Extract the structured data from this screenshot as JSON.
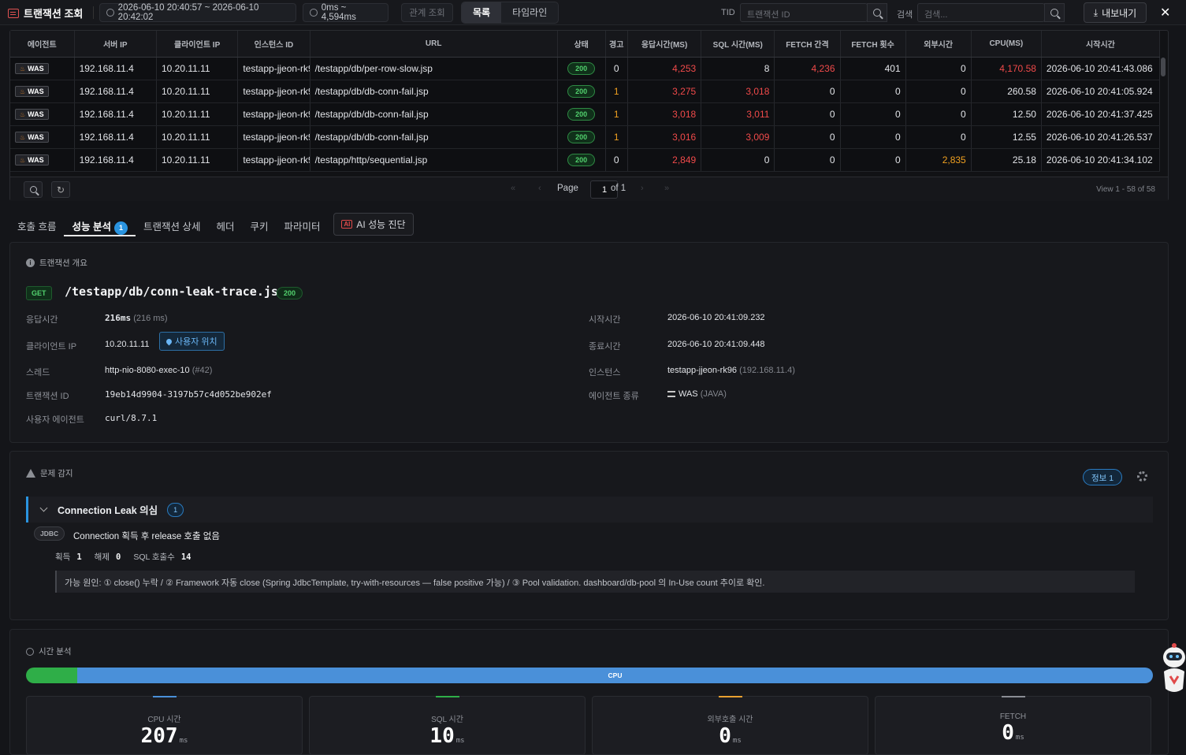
{
  "topbar": {
    "title": "트랜잭션 조회",
    "time_range": "2026-06-10 20:40:57 ~ 2026-06-10 20:42:02",
    "latency_range": "0ms ~ 4,594ms",
    "related_query": "관계 조회",
    "view_list": "목록",
    "view_timeline": "타임라인",
    "tid_label": "TID",
    "tid_placeholder": "트랜잭션 ID",
    "search_label": "검색",
    "search_placeholder": "검색...",
    "export_label": "내보내기"
  },
  "table": {
    "columns": [
      "에이전트",
      "서버 IP",
      "클라이언트 IP",
      "인스턴스 ID",
      "URL",
      "상태",
      "경고",
      "응답시간(MS)",
      "SQL 시간(MS)",
      "FETCH 간격",
      "FETCH 횟수",
      "외부시간",
      "CPU(MS)",
      "시작시간"
    ],
    "rows": [
      {
        "agent": "WAS",
        "server_ip": "192.168.11.4",
        "client_ip": "10.20.11.11",
        "instance": "testapp-jjeon-rk96",
        "url": "/testapp/db/per-row-slow.jsp",
        "status": "200",
        "warn": "0",
        "resp": "4,253",
        "sql": "8",
        "fetch_gap": "4,236",
        "fetch_cnt": "401",
        "ext": "0",
        "cpu": "4,170.58",
        "start": "2026-06-10 20:41:43.086"
      },
      {
        "agent": "WAS",
        "server_ip": "192.168.11.4",
        "client_ip": "10.20.11.11",
        "instance": "testapp-jjeon-rk96",
        "url": "/testapp/db/db-conn-fail.jsp",
        "status": "200",
        "warn": "1",
        "resp": "3,275",
        "sql": "3,018",
        "fetch_gap": "0",
        "fetch_cnt": "0",
        "ext": "0",
        "cpu": "260.58",
        "start": "2026-06-10 20:41:05.924"
      },
      {
        "agent": "WAS",
        "server_ip": "192.168.11.4",
        "client_ip": "10.20.11.11",
        "instance": "testapp-jjeon-rk96",
        "url": "/testapp/db/db-conn-fail.jsp",
        "status": "200",
        "warn": "1",
        "resp": "3,018",
        "sql": "3,011",
        "fetch_gap": "0",
        "fetch_cnt": "0",
        "ext": "0",
        "cpu": "12.50",
        "start": "2026-06-10 20:41:37.425"
      },
      {
        "agent": "WAS",
        "server_ip": "192.168.11.4",
        "client_ip": "10.20.11.11",
        "instance": "testapp-jjeon-rk96",
        "url": "/testapp/db/db-conn-fail.jsp",
        "status": "200",
        "warn": "1",
        "resp": "3,016",
        "sql": "3,009",
        "fetch_gap": "0",
        "fetch_cnt": "0",
        "ext": "0",
        "cpu": "12.55",
        "start": "2026-06-10 20:41:26.537"
      },
      {
        "agent": "WAS",
        "server_ip": "192.168.11.4",
        "client_ip": "10.20.11.11",
        "instance": "testapp-jjeon-rk96",
        "url": "/testapp/http/sequential.jsp",
        "status": "200",
        "warn": "0",
        "resp": "2,849",
        "sql": "0",
        "fetch_gap": "0",
        "fetch_cnt": "0",
        "ext": "2,835",
        "cpu": "25.18",
        "start": "2026-06-10 20:41:34.102"
      }
    ],
    "pager": {
      "page_label": "Page",
      "page": "1",
      "of_label": "of 1",
      "view_info": "View 1 - 58 of 58"
    }
  },
  "tabs": {
    "call_flow": "호출 흐름",
    "perf": "성능 분석",
    "perf_badge": "1",
    "tx_detail": "트랜잭션 상세",
    "header": "헤더",
    "cookie": "쿠키",
    "param": "파라미터",
    "ai_icon": "AI",
    "ai": "AI 성능 진단"
  },
  "overview": {
    "title": "트랜잭션 개요",
    "method": "GET",
    "url": "/testapp/db/conn-leak-trace.jsp",
    "status": "200",
    "resp_label": "응답시간",
    "resp_value": "216ms",
    "resp_sub": "(216 ms)",
    "client_label": "클라이언트 IP",
    "client_value": "10.20.11.11",
    "user_loc": "사용자 위치",
    "thread_label": "스레드",
    "thread_value": "http-nio-8080-exec-10",
    "thread_sub": "(#42)",
    "txid_label": "트랜잭션 ID",
    "txid_value": "19eb14d9904-3197b57c4d052be902ef",
    "ua_label": "사용자 에이전트",
    "ua_value": "curl/8.7.1",
    "start_label": "시작시간",
    "start_value": "2026-06-10 20:41:09.232",
    "end_label": "종료시간",
    "end_value": "2026-06-10 20:41:09.448",
    "inst_label": "인스턴스",
    "inst_value": "testapp-jjeon-rk96",
    "inst_sub": "(192.168.11.4)",
    "agent_label": "에이전트 종류",
    "agent_value": "WAS",
    "agent_sub": "(JAVA)"
  },
  "detect": {
    "title": "문제 감지",
    "info_pill": "정보 1",
    "item_title": "Connection Leak 의심",
    "item_badge": "1",
    "tag": "JDBC",
    "message": "Connection 획득 후 release 호출 없음",
    "acquire_label": "획득",
    "acquire": "1",
    "release_label": "해제",
    "release": "0",
    "sql_label": "SQL 호출수",
    "sql": "14",
    "cause": "가능 원인: ① close() 누락 / ② Framework 자동 close (Spring JdbcTemplate, try-with-resources — false positive 가능) / ③ Pool validation. dashboard/db-pool 의 In-Use count 추이로 확인."
  },
  "time": {
    "title": "시간 분석",
    "bar_label": "CPU",
    "cpu_label": "CPU 시간",
    "cpu_value": "207",
    "sql_label": "SQL 시간",
    "sql_value": "10",
    "ext_label": "외부호출 시간",
    "ext_value": "0",
    "fetch_label": "FETCH",
    "fetch_value": "0",
    "unit": "ms"
  },
  "colors": {
    "accent_blue": "#2a94e0",
    "status_green": "#52d16e",
    "error_red": "#f04a4a",
    "warn_orange": "#f0a020"
  }
}
